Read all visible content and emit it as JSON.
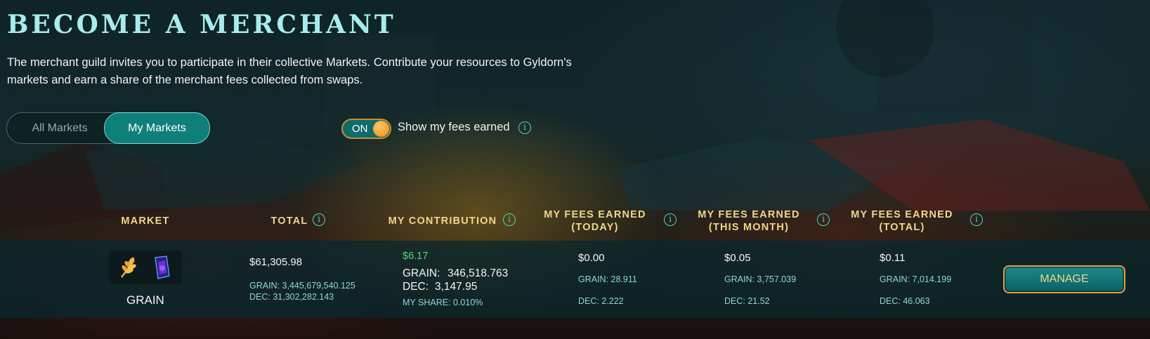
{
  "title": "BECOME A MERCHANT",
  "intro": "The merchant guild invites you to participate in their collective Markets. Contribute your resources to Gyldorn's markets and earn a share of the merchant fees collected from swaps.",
  "tabs": {
    "all": "All Markets",
    "my": "My Markets",
    "active": "My Markets"
  },
  "toggle": {
    "state": "ON",
    "label": "Show my fees earned"
  },
  "columns": {
    "market": "MARKET",
    "total": "TOTAL",
    "contribution": "MY CONTRIBUTION",
    "today": "MY FEES EARNED (TODAY)",
    "month": "MY FEES EARNED (THIS MONTH)",
    "total_fees": "MY FEES EARNED (TOTAL)"
  },
  "row": {
    "market_name": "GRAIN",
    "icons": [
      "wheat-icon",
      "dec-crystal-icon"
    ],
    "total": "$61,305.98",
    "total_grain": "GRAIN: 3,445,679,540.125",
    "total_dec": "DEC: 31,302,282.143",
    "contribution_usd": "$6.17",
    "contribution_grain_label": "GRAIN:",
    "contribution_grain": "346,518.763",
    "contribution_dec_label": "DEC:",
    "contribution_dec": "3,147.95",
    "my_share": "MY SHARE: 0.010%",
    "today_usd": "$0.00",
    "today_grain": "GRAIN: 28.911",
    "today_dec": "DEC: 2.222",
    "month_usd": "$0.05",
    "month_grain": "GRAIN: 3,757.039",
    "month_dec": "DEC: 21.52",
    "total_usd": "$0.11",
    "total_fees_grain": "GRAIN: 7,014.199",
    "total_fees_dec": "DEC: 46.063",
    "manage": "MANAGE"
  },
  "colors": {
    "accent": "#0f7f7a",
    "title": "#a7ecea",
    "header": "#f1d68c",
    "positive": "#56d37a",
    "toggle_border": "#d08a2c"
  }
}
